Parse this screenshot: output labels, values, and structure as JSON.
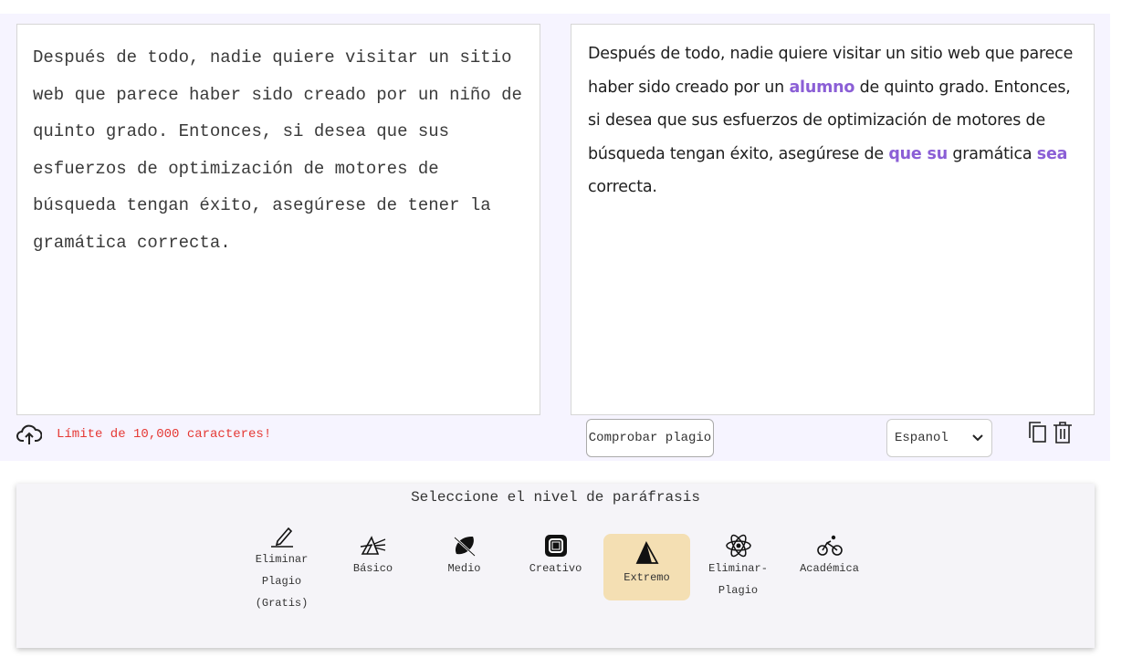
{
  "input_text": "Después de todo, nadie quiere visitar un sitio web que parece haber sido creado por un niño de quinto grado. Entonces, si desea que sus esfuerzos de optimización de motores de búsqueda tengan éxito, asegúrese de tener la gramática correcta.",
  "output": {
    "seg1": "Después de todo, nadie quiere visitar un sitio web que parece haber sido creado por un ",
    "hl1": "alumno",
    "seg2": " de quinto grado. Entonces, si desea que sus esfuerzos de optimización de motores de búsqueda tengan éxito, asegúrese de ",
    "hl2": "que su",
    "seg3": " gramática ",
    "hl3": "sea",
    "seg4": " correcta."
  },
  "char_limit": "Límite de 10,000 caracteres!",
  "check_button": "Comprobar plagio",
  "language_selected": "Espanol",
  "level_title": "Seleccione el nivel de paráfrasis",
  "modes": [
    {
      "label": "Eliminar\nPlagio\n(Gratis)",
      "icon": "pen-icon"
    },
    {
      "label": "Básico",
      "icon": "prism-icon"
    },
    {
      "label": "Medio",
      "icon": "surfboard-icon"
    },
    {
      "label": "Creativo",
      "icon": "square-swirl-icon"
    },
    {
      "label": "Extremo",
      "icon": "pyramid-icon",
      "active": true
    },
    {
      "label": "Eliminar-\nPlagio",
      "icon": "atom-icon"
    },
    {
      "label": "Académica",
      "icon": "bicycle-icon"
    }
  ],
  "colors": {
    "highlight": "#8b5fd6",
    "active_mode": "#f4dfb3",
    "limit_text": "#e53935"
  }
}
